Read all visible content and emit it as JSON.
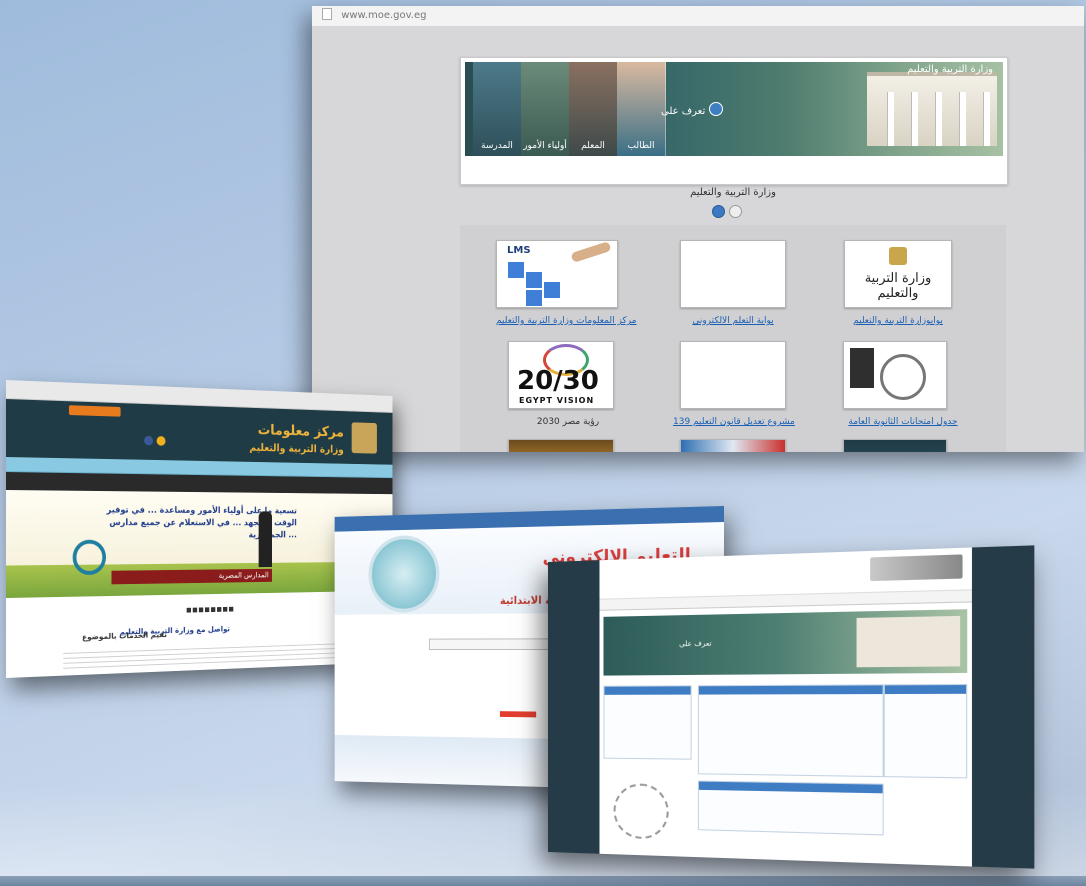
{
  "browser": {
    "url": "www.moe.gov.eg"
  },
  "main_site": {
    "slider": {
      "panels": [
        "الطالب",
        "المعلم",
        "أولياء الأمور",
        "المدرسة"
      ],
      "know_label": "تعرف على",
      "building_title": "وزارة التربية والتعليم"
    },
    "caption": "وزارة التربية والتعليم",
    "slider_dots": 2,
    "tiles": [
      {
        "label": "مركز المعلومات وزارة التربية والتعليم",
        "icon": "lms-icon"
      },
      {
        "label": "بوابة التعلم الالكتروني",
        "icon": "elearning-icon"
      },
      {
        "label": "بوابوزارة التربية والتعليم",
        "icon": "ministry-logo-icon"
      },
      {
        "label": "رؤية مصر 2030",
        "icon": "egypt-vision-2030-icon",
        "img_big": "20/30",
        "img_small": "EGYPT VISION"
      },
      {
        "label": "مشروع تعديل قانون التعليم 139",
        "icon": "law-books-icon"
      },
      {
        "label": "جدول امتحانات الثانوية العامة",
        "icon": "exam-schedule-clock-icon"
      }
    ]
  },
  "info_center_site": {
    "title_line1": "مركز معلومات",
    "title_line2": "وزارة التربية والتعليم",
    "slogan": "تسعية ما على أولياء الأمور ومساعدة ... في توفير الوقت و الجهد ... في الاستعلام عن جميع مدارس الجمهورية ...",
    "ribbon": "المدارس المصرية",
    "footer_a": "تواصل مع وزارة التربية والتعليم",
    "footer_b": "نقيم الخدمات بالموضوع"
  },
  "elearning_site": {
    "title": "التعليم الإلكتروني",
    "subtitle": "المرحلة الابتدائية"
  },
  "ministry_portal": {
    "banner_label": "تعرف على"
  },
  "colors": {
    "link": "#1a5fb4",
    "info_header": "#1f3b45",
    "info_title": "#f0b43c",
    "accent_red": "#d93d3d"
  }
}
